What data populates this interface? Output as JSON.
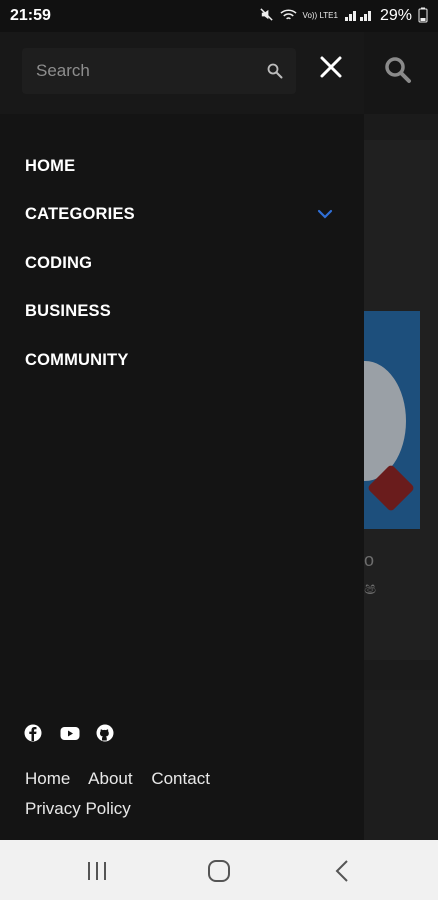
{
  "status": {
    "time": "21:59",
    "carrier": "Vo)) LTE1",
    "battery": "29%"
  },
  "search": {
    "placeholder": "Search"
  },
  "menu": {
    "items": [
      {
        "label": "HOME"
      },
      {
        "label": "CATEGORIES"
      },
      {
        "label": "CODING"
      },
      {
        "label": "BUSINESS"
      },
      {
        "label": "COMMUNITY"
      }
    ]
  },
  "footer": {
    "social_icons": [
      "facebook-icon",
      "youtube-icon",
      "github-icon"
    ],
    "links": [
      "Home",
      "About",
      "Contact",
      "Privacy Policy"
    ]
  },
  "background": {
    "text_line1": "o",
    "text_line2": "ෂ"
  },
  "colors": {
    "drawer_bg": "#141414",
    "accent_chevron": "#2f6fd6",
    "navbar_bg": "#f1f1f1"
  }
}
